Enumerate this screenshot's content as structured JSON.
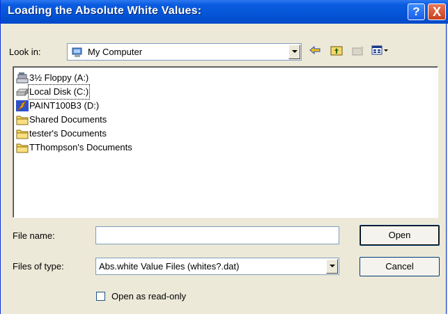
{
  "dialog": {
    "title": "Loading the Absolute White Values:",
    "help_button": "?",
    "close_button": "X"
  },
  "look_in": {
    "label": "Look in:",
    "value": "My Computer"
  },
  "toolbar": {
    "icons": [
      "back-icon",
      "up-folder-icon",
      "new-folder-icon",
      "view-menu-icon"
    ]
  },
  "file_list": {
    "items": [
      {
        "label": "3½ Floppy (A:)",
        "icon": "floppy-drive-icon"
      },
      {
        "label": "Local Disk (C:)",
        "icon": "hard-disk-icon",
        "focused": true
      },
      {
        "label": "PAINT100B3 (D:)",
        "icon": "cd-drive-icon"
      },
      {
        "label": "Shared Documents",
        "icon": "folder-icon"
      },
      {
        "label": "tester's Documents",
        "icon": "folder-icon"
      },
      {
        "label": "TThompson's Documents",
        "icon": "folder-icon"
      }
    ]
  },
  "file_name": {
    "label": "File name:",
    "value": ""
  },
  "files_of_type": {
    "label": "Files of type:",
    "value": "Abs.white Value Files (whites?.dat)"
  },
  "buttons": {
    "open": "Open",
    "cancel": "Cancel"
  },
  "read_only": {
    "label": "Open as read-only",
    "checked": false
  }
}
